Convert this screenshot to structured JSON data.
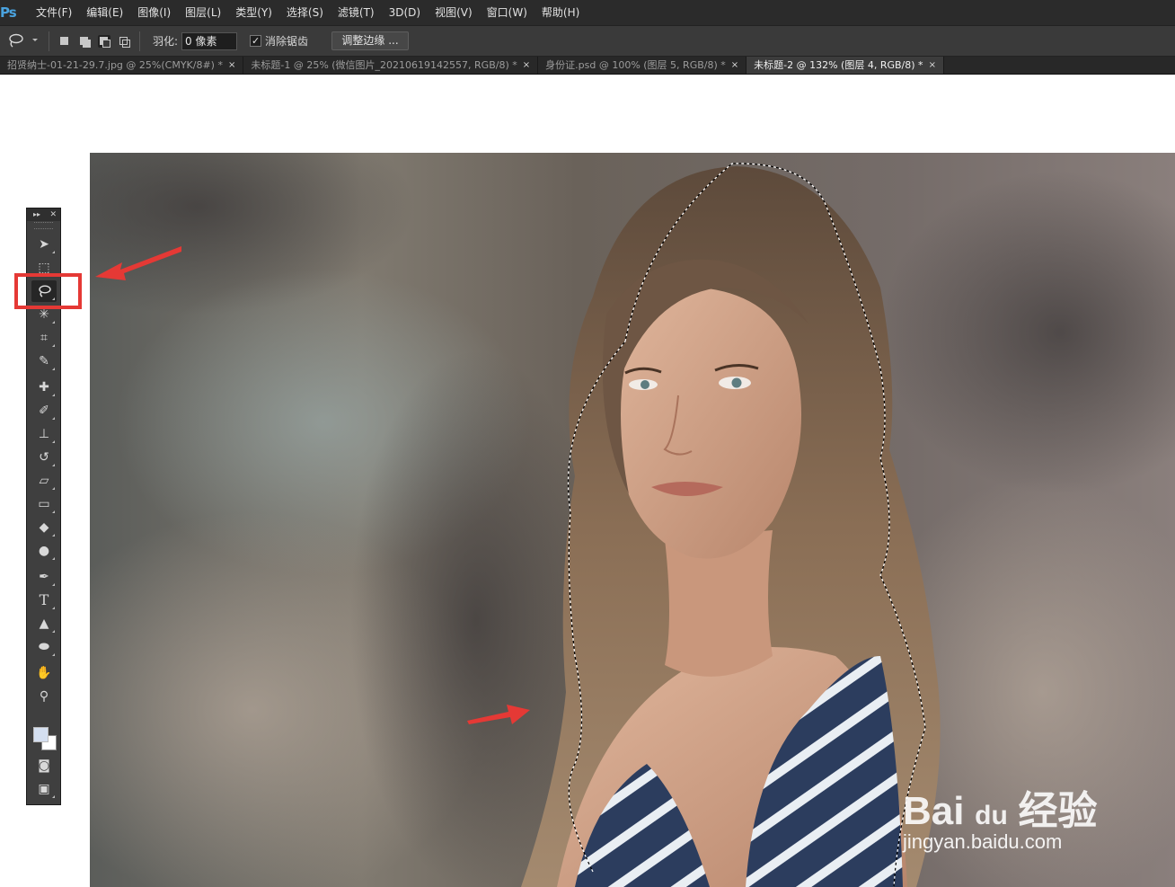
{
  "app": {
    "logo": "Ps"
  },
  "menu": [
    "文件(F)",
    "编辑(E)",
    "图像(I)",
    "图层(L)",
    "类型(Y)",
    "选择(S)",
    "滤镜(T)",
    "3D(D)",
    "视图(V)",
    "窗口(W)",
    "帮助(H)"
  ],
  "options": {
    "feather_label": "羽化:",
    "feather_value": "0 像素",
    "antialias_checked": "✓",
    "antialias_label": "消除锯齿",
    "refine_edge_label": "调整边缘 ..."
  },
  "tabs": [
    {
      "label": "招贤纳士-01-21-29.7.jpg @ 25%(CMYK/8#) *",
      "close": "×",
      "active": false
    },
    {
      "label": "未标题-1 @ 25% (微信图片_20210619142557, RGB/8) *",
      "close": "×",
      "active": false
    },
    {
      "label": "身份证.psd @ 100% (图层 5, RGB/8) *",
      "close": "×",
      "active": false
    },
    {
      "label": "未标题-2 @ 132% (图层 4, RGB/8) *",
      "close": "×",
      "active": true
    }
  ],
  "tools_panel": {
    "collapse_glyph": "▸▸",
    "close_glyph": "✕",
    "items": [
      {
        "name": "move-tool",
        "icon": "move-icon",
        "glyph": "➤"
      },
      {
        "name": "marquee-tool",
        "icon": "marquee-icon",
        "glyph": "⬚"
      },
      {
        "name": "lasso-tool",
        "icon": "lasso-icon",
        "glyph": "",
        "active": true
      },
      {
        "name": "magic-wand-tool",
        "icon": "magic-wand-icon",
        "glyph": "✳"
      },
      {
        "name": "crop-tool",
        "icon": "crop-icon",
        "glyph": "⌗"
      },
      {
        "name": "eyedropper-tool",
        "icon": "eyedropper-icon",
        "glyph": "✎"
      },
      {
        "name": "healing-brush-tool",
        "icon": "bandage-icon",
        "glyph": "✚"
      },
      {
        "name": "brush-tool",
        "icon": "brush-icon",
        "glyph": "✐"
      },
      {
        "name": "clone-stamp-tool",
        "icon": "stamp-icon",
        "glyph": "⊥"
      },
      {
        "name": "history-brush-tool",
        "icon": "history-brush-icon",
        "glyph": "↺"
      },
      {
        "name": "eraser-tool",
        "icon": "eraser-icon",
        "glyph": "▱"
      },
      {
        "name": "gradient-tool",
        "icon": "gradient-icon",
        "glyph": "▭"
      },
      {
        "name": "blur-tool",
        "icon": "blur-icon",
        "glyph": "◆"
      },
      {
        "name": "dodge-tool",
        "icon": "dodge-icon",
        "glyph": "●"
      },
      {
        "name": "pen-tool",
        "icon": "pen-icon",
        "glyph": "✒"
      },
      {
        "name": "type-tool",
        "icon": "type-icon",
        "glyph": "T"
      },
      {
        "name": "path-selection-tool",
        "icon": "arrow-icon",
        "glyph": "▲"
      },
      {
        "name": "ellipse-tool",
        "icon": "ellipse-icon",
        "glyph": "⬬"
      },
      {
        "name": "hand-tool",
        "icon": "hand-icon",
        "glyph": "✋"
      },
      {
        "name": "zoom-tool",
        "icon": "zoom-icon",
        "glyph": "⚲"
      }
    ],
    "quick_mask_glyph": "◙",
    "screen_mode_glyph": "▣",
    "foreground_color": "#d4dff0",
    "background_color": "#ffffff"
  },
  "watermark": {
    "brand": "Bai",
    "paw": "du",
    "cn": "经验",
    "url": "jingyan.baidu.com"
  },
  "colors": {
    "menubar": "#2b2b2b",
    "options": "#3a3a3a",
    "annotation": "#e53935"
  }
}
